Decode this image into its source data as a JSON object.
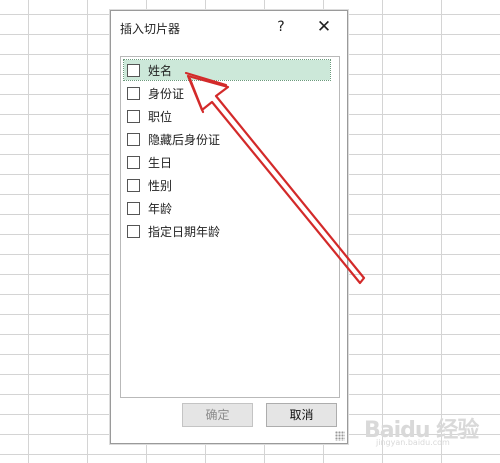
{
  "dialog": {
    "title": "插入切片器",
    "help_label": "?",
    "close_label": "✕",
    "fields": [
      {
        "label": "姓名",
        "checked": false,
        "selected": true
      },
      {
        "label": "身份证",
        "checked": false,
        "selected": false
      },
      {
        "label": "职位",
        "checked": false,
        "selected": false
      },
      {
        "label": "隐藏后身份证",
        "checked": false,
        "selected": false
      },
      {
        "label": "生日",
        "checked": false,
        "selected": false
      },
      {
        "label": "性别",
        "checked": false,
        "selected": false
      },
      {
        "label": "年龄",
        "checked": false,
        "selected": false
      },
      {
        "label": "指定日期年龄",
        "checked": false,
        "selected": false
      }
    ],
    "ok_label": "确定",
    "ok_enabled": false,
    "cancel_label": "取消"
  },
  "annotation": {
    "icon": "arrow-icon",
    "color": "#d32a2a"
  },
  "watermark": {
    "main": "Baidu 经验",
    "sub": "jingyan.baidu.com"
  }
}
